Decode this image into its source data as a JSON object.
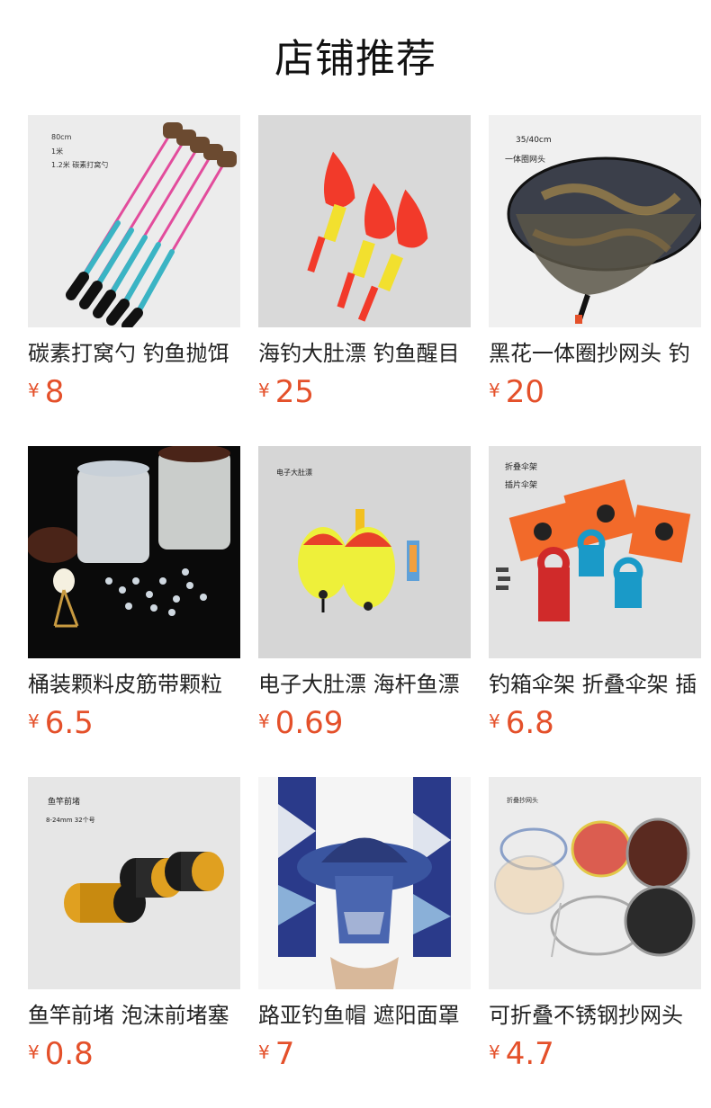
{
  "header": {
    "title": "店铺推荐"
  },
  "currency_symbol": "¥",
  "accent_color": "#e4502a",
  "products": [
    {
      "name": "碳素打窝勺 钓鱼抛饵",
      "price": "8",
      "image_icon": "bait-spoon-icon",
      "image_caption": [
        "80cm",
        "1米",
        "1.2米 碳素打窝勺"
      ]
    },
    {
      "name": "海钓大肚漂 钓鱼醒目",
      "price": "25",
      "image_icon": "fishing-float-icon",
      "image_caption": []
    },
    {
      "name": "黑花一体圈抄网头 钓",
      "price": "20",
      "image_icon": "landing-net-icon",
      "image_caption": [
        "35/40cm",
        "一体圈网头"
      ]
    },
    {
      "name": "桶装颗料皮筋带颗粒",
      "price": "6.5",
      "image_icon": "rubber-beads-icon",
      "image_caption": []
    },
    {
      "name": "电子大肚漂 海杆鱼漂",
      "price": "0.69",
      "image_icon": "electronic-float-icon",
      "image_caption": [
        "电子大肚漂"
      ]
    },
    {
      "name": "钓箱伞架 折叠伞架 插",
      "price": "6.8",
      "image_icon": "umbrella-stand-icon",
      "image_caption": [
        "折叠伞架",
        "插片伞架"
      ]
    },
    {
      "name": "鱼竿前堵 泡沫前堵塞",
      "price": "0.8",
      "image_icon": "rod-plug-icon",
      "image_caption": [
        "鱼竿前堵",
        "8-24mm 32个号"
      ]
    },
    {
      "name": "路亚钓鱼帽 遮阳面罩",
      "price": "7",
      "image_icon": "fishing-hat-icon",
      "image_caption": []
    },
    {
      "name": "可折叠不锈钢抄网头",
      "price": "4.7",
      "image_icon": "folding-net-icon",
      "image_caption": [
        "折叠抄网头"
      ]
    }
  ]
}
